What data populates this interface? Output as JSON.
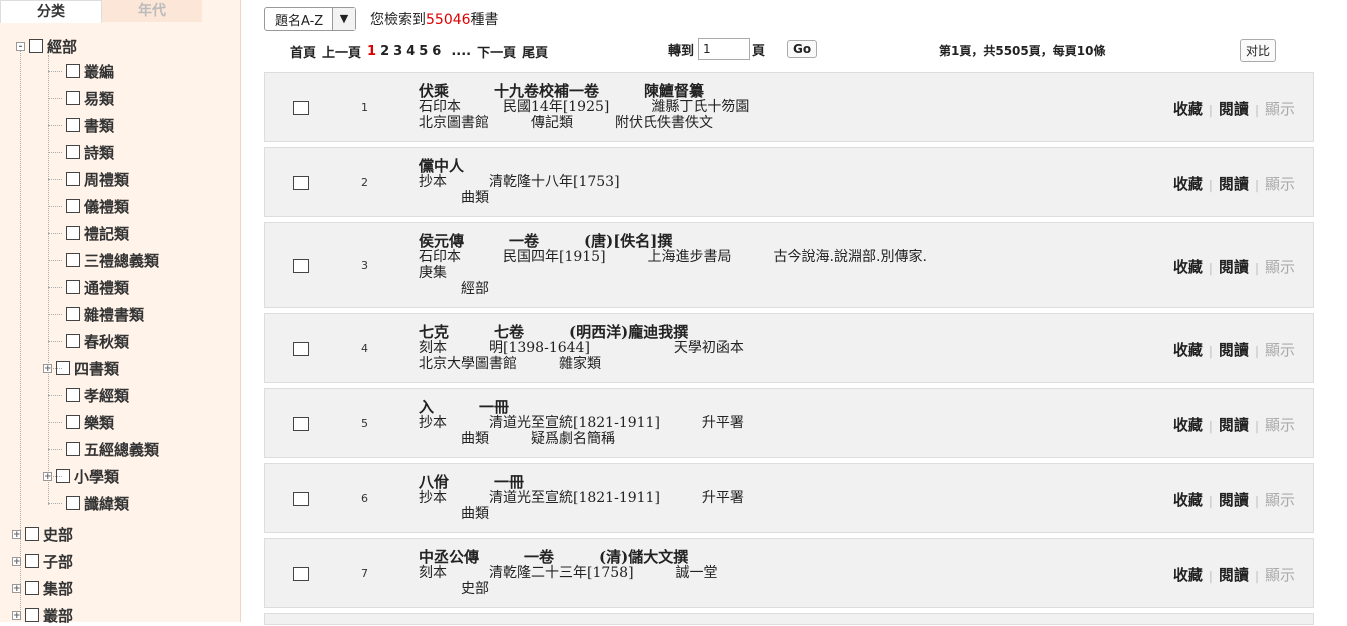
{
  "sidebar": {
    "tabs": [
      "分类",
      "年代"
    ],
    "root": "經部",
    "children": [
      "叢編",
      "易類",
      "書類",
      "詩類",
      "周禮類",
      "儀禮類",
      "禮記類",
      "三禮總義類",
      "通禮類",
      "雜禮書類",
      "春秋類",
      "四書類",
      "孝經類",
      "樂類",
      "五經總義類",
      "小學類",
      "讖緯類"
    ],
    "others": [
      "史部",
      "子部",
      "集部",
      "叢部"
    ]
  },
  "sort": {
    "value": "題名A-Z"
  },
  "found": {
    "prefix": "您檢索到",
    "count": "55046",
    "suffix": "種書"
  },
  "pager": {
    "first": "首頁",
    "prev": "上一頁",
    "pages": [
      "1",
      "2",
      "3",
      "4",
      "5",
      "6"
    ],
    "ellipsis": "....",
    "next": "下一頁",
    "last": "尾頁",
    "goto_label": "轉到",
    "goto_value": "1",
    "page_unit": "頁",
    "go": "Go",
    "info": "第1頁，共5505頁，每頁10條",
    "compare": "对比"
  },
  "actions": {
    "collect": "收藏",
    "read": "閱讀",
    "show": "顯示"
  },
  "results": [
    {
      "idx": "1",
      "lines": [
        "伏乘　　　十九卷校補一卷　　　陳鱣督纂",
        "石印本　　　民國14年[1925]　　　濰縣丁氏十笏園",
        "北京圖書館　　　傳記類　　　附伏氏佚書佚文"
      ]
    },
    {
      "idx": "2",
      "lines": [
        "儻中人",
        "抄本　　　清乾隆十八年[1753]",
        "　　　曲類"
      ]
    },
    {
      "idx": "3",
      "lines": [
        "侯元傳　　　一卷　　　(唐)[佚名]撰",
        "石印本　　　民国四年[1915]　　　上海進步書局　　　古今說海.說淵部.別傳家.",
        "庚集",
        "　　　經部"
      ]
    },
    {
      "idx": "4",
      "lines": [
        "七克　　　七卷　　　(明西洋)龐迪我撰",
        "刻本　　　明[1398-1644]　　　　　　天學初函本",
        "北京大學圖書館　　　雜家類"
      ]
    },
    {
      "idx": "5",
      "lines": [
        "入　　　一冊",
        "抄本　　　清道光至宣統[1821-1911]　　　升平署",
        "　　　曲類　　　疑爲劇名簡稱"
      ]
    },
    {
      "idx": "6",
      "lines": [
        "八佾　　　一冊",
        "抄本　　　清道光至宣統[1821-1911]　　　升平署",
        "　　　曲類"
      ]
    },
    {
      "idx": "7",
      "lines": [
        "中丞公傳　　　一卷　　　(清)儲大文撰",
        "刻本　　　清乾隆二十三年[1758]　　　誠一堂",
        "　　　史部"
      ]
    }
  ]
}
